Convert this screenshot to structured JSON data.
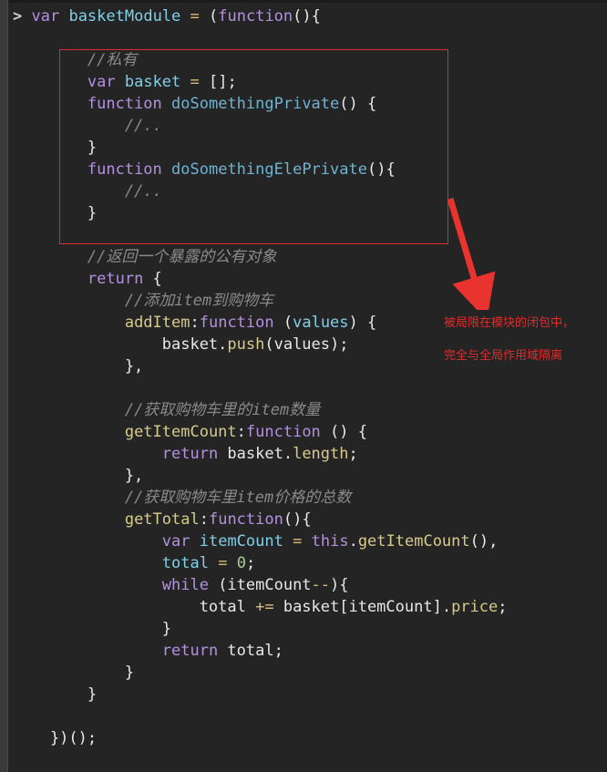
{
  "editor": {
    "background_color": "#242424",
    "prompt_glyph": ">",
    "lines": [
      [
        {
          "t": "prompt",
          "s": "> "
        },
        {
          "t": "kw",
          "s": "var"
        },
        {
          "t": "plain",
          "s": " "
        },
        {
          "t": "ident",
          "s": "basketModule"
        },
        {
          "t": "plain",
          "s": " "
        },
        {
          "t": "op",
          "s": "="
        },
        {
          "t": "plain",
          "s": " ("
        },
        {
          "t": "kw",
          "s": "function"
        },
        {
          "t": "plain",
          "s": "(){"
        }
      ],
      [],
      [
        {
          "t": "plain",
          "s": "        "
        },
        {
          "t": "cmt",
          "s": "//私有"
        }
      ],
      [
        {
          "t": "plain",
          "s": "        "
        },
        {
          "t": "kw",
          "s": "var"
        },
        {
          "t": "plain",
          "s": " "
        },
        {
          "t": "ident",
          "s": "basket"
        },
        {
          "t": "plain",
          "s": " "
        },
        {
          "t": "op",
          "s": "="
        },
        {
          "t": "plain",
          "s": " [];"
        }
      ],
      [
        {
          "t": "plain",
          "s": "        "
        },
        {
          "t": "kw",
          "s": "function"
        },
        {
          "t": "plain",
          "s": " "
        },
        {
          "t": "fn",
          "s": "doSomethingPrivate"
        },
        {
          "t": "plain",
          "s": "() {"
        }
      ],
      [
        {
          "t": "plain",
          "s": "            "
        },
        {
          "t": "cmt",
          "s": "//.."
        }
      ],
      [
        {
          "t": "plain",
          "s": "        }"
        }
      ],
      [
        {
          "t": "plain",
          "s": "        "
        },
        {
          "t": "kw",
          "s": "function"
        },
        {
          "t": "plain",
          "s": " "
        },
        {
          "t": "fn",
          "s": "doSomethingElePrivate"
        },
        {
          "t": "plain",
          "s": "(){"
        }
      ],
      [
        {
          "t": "plain",
          "s": "            "
        },
        {
          "t": "cmt",
          "s": "//.."
        }
      ],
      [
        {
          "t": "plain",
          "s": "        }"
        }
      ],
      [],
      [
        {
          "t": "plain",
          "s": "        "
        },
        {
          "t": "cmt",
          "s": "//返回一个暴露的公有对象"
        }
      ],
      [
        {
          "t": "plain",
          "s": "        "
        },
        {
          "t": "kw",
          "s": "return"
        },
        {
          "t": "plain",
          "s": " {"
        }
      ],
      [
        {
          "t": "plain",
          "s": "            "
        },
        {
          "t": "cmt",
          "s": "//添加item到购物车"
        }
      ],
      [
        {
          "t": "plain",
          "s": "            "
        },
        {
          "t": "prop",
          "s": "addItem"
        },
        {
          "t": "plain",
          "s": ":"
        },
        {
          "t": "kw",
          "s": "function"
        },
        {
          "t": "plain",
          "s": " ("
        },
        {
          "t": "param",
          "s": "values"
        },
        {
          "t": "plain",
          "s": ") {"
        }
      ],
      [
        {
          "t": "plain",
          "s": "                basket."
        },
        {
          "t": "prop",
          "s": "push"
        },
        {
          "t": "plain",
          "s": "(values);"
        }
      ],
      [
        {
          "t": "plain",
          "s": "            },"
        }
      ],
      [],
      [
        {
          "t": "plain",
          "s": "            "
        },
        {
          "t": "cmt",
          "s": "//获取购物车里的item数量"
        }
      ],
      [
        {
          "t": "plain",
          "s": "            "
        },
        {
          "t": "prop",
          "s": "getItemCount"
        },
        {
          "t": "plain",
          "s": ":"
        },
        {
          "t": "kw",
          "s": "function"
        },
        {
          "t": "plain",
          "s": " () {"
        }
      ],
      [
        {
          "t": "plain",
          "s": "                "
        },
        {
          "t": "kw",
          "s": "return"
        },
        {
          "t": "plain",
          "s": " basket."
        },
        {
          "t": "prop",
          "s": "length"
        },
        {
          "t": "plain",
          "s": ";"
        }
      ],
      [
        {
          "t": "plain",
          "s": "            },"
        }
      ],
      [
        {
          "t": "plain",
          "s": "            "
        },
        {
          "t": "cmt",
          "s": "//获取购物车里item价格的总数"
        }
      ],
      [
        {
          "t": "plain",
          "s": "            "
        },
        {
          "t": "prop",
          "s": "getTotal"
        },
        {
          "t": "plain",
          "s": ":"
        },
        {
          "t": "kw",
          "s": "function"
        },
        {
          "t": "plain",
          "s": "(){"
        }
      ],
      [
        {
          "t": "plain",
          "s": "                "
        },
        {
          "t": "kw",
          "s": "var"
        },
        {
          "t": "plain",
          "s": " "
        },
        {
          "t": "ident",
          "s": "itemCount"
        },
        {
          "t": "plain",
          "s": " "
        },
        {
          "t": "op",
          "s": "="
        },
        {
          "t": "plain",
          "s": " "
        },
        {
          "t": "kw",
          "s": "this"
        },
        {
          "t": "plain",
          "s": "."
        },
        {
          "t": "prop",
          "s": "getItemCount"
        },
        {
          "t": "plain",
          "s": "(),"
        }
      ],
      [
        {
          "t": "plain",
          "s": "                "
        },
        {
          "t": "ident",
          "s": "total"
        },
        {
          "t": "plain",
          "s": " "
        },
        {
          "t": "op",
          "s": "="
        },
        {
          "t": "plain",
          "s": " "
        },
        {
          "t": "num",
          "s": "0"
        },
        {
          "t": "plain",
          "s": ";"
        }
      ],
      [
        {
          "t": "plain",
          "s": "                "
        },
        {
          "t": "kw",
          "s": "while"
        },
        {
          "t": "plain",
          "s": " (itemCount"
        },
        {
          "t": "op",
          "s": "--"
        },
        {
          "t": "plain",
          "s": "){"
        }
      ],
      [
        {
          "t": "plain",
          "s": "                    total "
        },
        {
          "t": "op",
          "s": "+="
        },
        {
          "t": "plain",
          "s": " basket[itemCount]."
        },
        {
          "t": "prop",
          "s": "price"
        },
        {
          "t": "plain",
          "s": ";"
        }
      ],
      [
        {
          "t": "plain",
          "s": "                }"
        }
      ],
      [
        {
          "t": "plain",
          "s": "                "
        },
        {
          "t": "kw",
          "s": "return"
        },
        {
          "t": "plain",
          "s": " total;"
        }
      ],
      [
        {
          "t": "plain",
          "s": "            }"
        }
      ],
      [
        {
          "t": "plain",
          "s": "        }"
        }
      ],
      [],
      [
        {
          "t": "plain",
          "s": "    })();"
        }
      ]
    ]
  },
  "annotation": {
    "box_color": "#e02b2b",
    "arrow_color": "#e8332e",
    "text_color": "#e02b2b",
    "text": "被局限在模块的闭包中，\n完全与全局作用域隔离",
    "text_line_1": "被局限在模块的闭包中，",
    "text_line_2": "完全与全局作用域隔离"
  }
}
